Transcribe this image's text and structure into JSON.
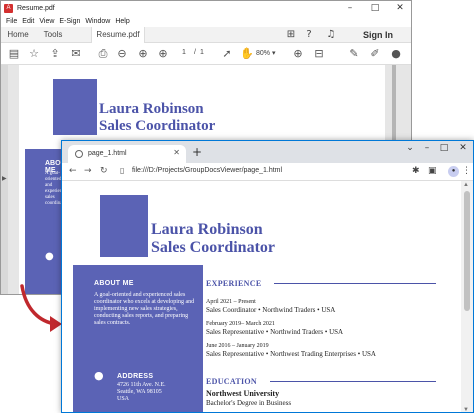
{
  "pdf_window": {
    "title": "Resume.pdf",
    "menu": [
      "File",
      "Edit",
      "View",
      "E-Sign",
      "Window",
      "Help"
    ],
    "tabs": [
      "Home",
      "Tools",
      "Resume.pdf"
    ],
    "sign_in": "Sign In",
    "page_current": "1",
    "page_sep": "/",
    "page_total": "1",
    "zoom": "80%",
    "resume": {
      "name": "Laura Robinson",
      "title": "Sales Coordinator",
      "about_heading": "ABOUT ME",
      "about_text": "A goal-oriented and experienced sales coordinator who excels at developing and implementing new sales strategies, conducting sales reports, and preparing sales contracts."
    }
  },
  "browser_window": {
    "tab_title": "page_1.html",
    "url": "file:///D:/Projects/GroupDocsViewer/page_1.html",
    "resume": {
      "name": "Laura Robinson",
      "title": "Sales Coordinator",
      "about_heading": "ABOUT ME",
      "about_text": "A goal-oriented and experienced sales coordinator who excels at developing and implementing new sales strategies, conducting sales reports, and preparing sales contracts.",
      "address_heading": "ADDRESS",
      "address_lines": [
        "4726 11th Ave. N.E.",
        "Seattle, WA 98105",
        "USA"
      ],
      "experience_heading": "EXPERIENCE",
      "jobs": [
        {
          "dates": "April 2021 – Present",
          "role": "Sales Coordinator • Northwind Traders • USA"
        },
        {
          "dates": "February 2019– March 2021",
          "role": "Sales Representative • Northwind Traders • USA"
        },
        {
          "dates": "June 2016 – January 2019",
          "role": "Sales Representative • Northwest Trading Enterprises • USA"
        }
      ],
      "education_heading": "EDUCATION",
      "school": "Northwest University",
      "degree": "Bachelor's Degree in Business"
    }
  },
  "colors": {
    "accent": "#5b63b5",
    "heading": "#4b53a8",
    "arrow": "#c0282d",
    "browser_border": "#0078d7"
  },
  "icons": [
    "pdf-app-icon",
    "star-icon",
    "save-icon",
    "print-icon",
    "zoom-out-icon",
    "cursor-icon",
    "hand-icon",
    "pin-icon",
    "arrow-icon"
  ]
}
